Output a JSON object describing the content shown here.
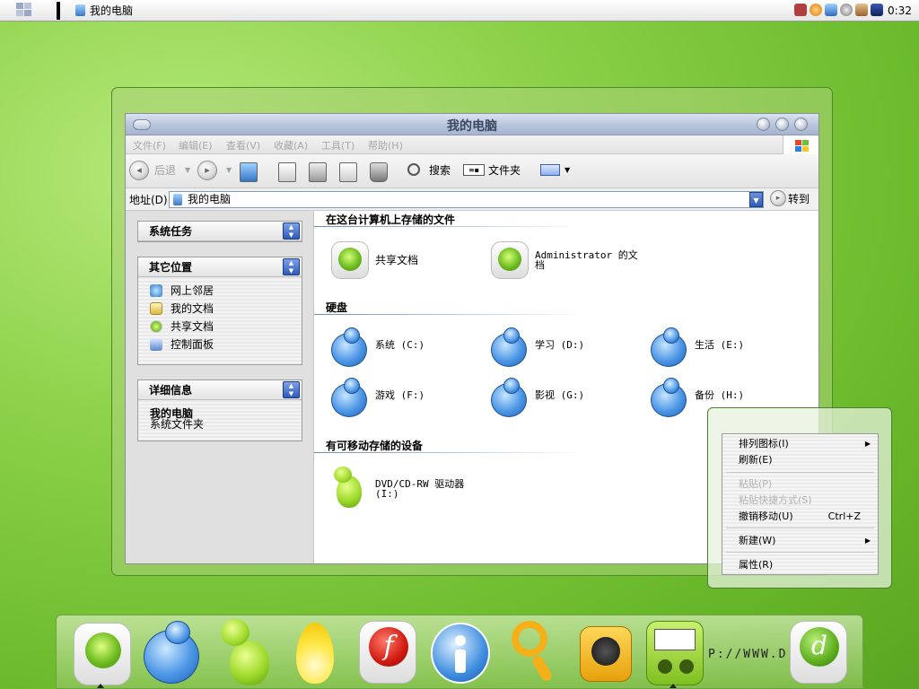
{
  "taskbar": {
    "active_window": "我的电脑",
    "clock": "0:32"
  },
  "window": {
    "title": "我的电脑",
    "menu": [
      "文件(F)",
      "编辑(E)",
      "查看(V)",
      "收藏(A)",
      "工具(T)",
      "帮助(H)"
    ],
    "toolbar": {
      "back": "后退",
      "search": "搜索",
      "folders": "文件夹"
    },
    "address": {
      "label": "地址(D)",
      "value": "我的电脑",
      "go": "转到"
    }
  },
  "sidebar": {
    "system_tasks": {
      "title": "系统任务"
    },
    "other_places": {
      "title": "其它位置",
      "items": [
        {
          "label": "网上邻居",
          "icon": "network-icon"
        },
        {
          "label": "我的文档",
          "icon": "documents-icon"
        },
        {
          "label": "共享文档",
          "icon": "shared-docs-icon"
        },
        {
          "label": "控制面板",
          "icon": "control-panel-icon"
        }
      ]
    },
    "details": {
      "title": "详细信息",
      "name": "我的电脑",
      "type": "系统文件夹"
    }
  },
  "content": {
    "group_stored": "在这台计算机上存储的文件",
    "shared_docs": "共享文档",
    "admin_docs_line1": "Administrator 的文",
    "admin_docs_line2": "档",
    "group_hdd": "硬盘",
    "drives": [
      "系统 (C:)",
      "学习 (D:)",
      "生活 (E:)",
      "游戏 (F:)",
      "影视 (G:)",
      "备份 (H:)"
    ],
    "group_removable": "有可移动存储的设备",
    "dvd_line1": "DVD/CD-RW 驱动器",
    "dvd_line2": "(I:)"
  },
  "context_menu": {
    "arrange": "排列图标(I)",
    "refresh": "刷新(E)",
    "paste": "粘贴(P)",
    "paste_shortcut": "粘贴快捷方式(S)",
    "undo_move": "撤销移动(U)",
    "undo_shortcut": "Ctrl+Z",
    "new": "新建(W)",
    "properties": "属性(R)"
  },
  "dock": {
    "url_text": "P://WWW.D          Y.NET",
    "icons": [
      "shared-disk-icon",
      "drive-icon",
      "dvd-mascot-icon",
      "flame-icon",
      "flash-icon",
      "info-icon",
      "magnifier-icon",
      "speaker-icon",
      "meter-icon",
      "dreamweaver-icon"
    ]
  },
  "colors": {
    "desktop": "#7cc63a",
    "title_bar": "#b7c4dc",
    "accent_blue": "#2f59b6"
  }
}
